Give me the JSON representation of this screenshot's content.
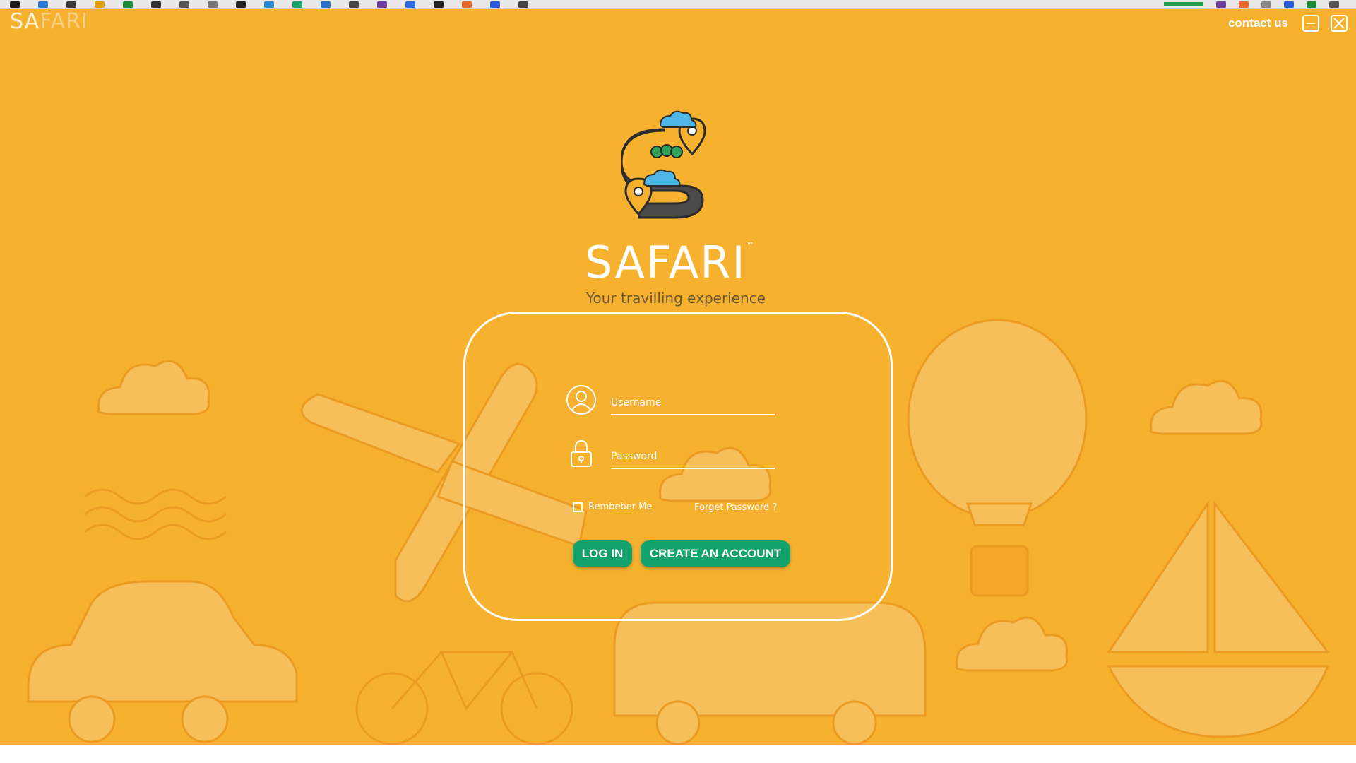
{
  "app": {
    "title_part1": "SA",
    "title_part2": "FARI",
    "contact_label": "contact us",
    "colors": {
      "background": "#f6b12f",
      "button": "#12a26b",
      "text": "#ffffff",
      "tagline": "#6a5638"
    }
  },
  "brand": {
    "name": "SAFARI",
    "trademark": "™",
    "tagline": "Your travilling experience"
  },
  "login": {
    "username_placeholder": "Username",
    "password_placeholder": "Password",
    "remember_label": "Rembeber Me",
    "forgot_label": "Forget Password ?",
    "login_button": "LOG IN",
    "create_button": "CREATE AN ACCOUNT"
  },
  "icons": [
    "user-icon",
    "lock-icon",
    "minimize-icon",
    "close-icon",
    "safari-logo-icon"
  ]
}
